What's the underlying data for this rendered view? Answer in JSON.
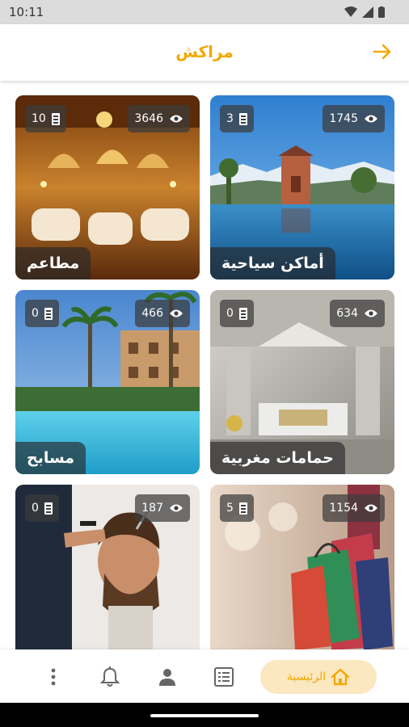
{
  "status_bar": {
    "time": "10:11"
  },
  "header": {
    "title": "مراكش"
  },
  "categories": [
    {
      "name": "أماكن سياحية",
      "views": "1745",
      "count": "3"
    },
    {
      "name": "مطاعم",
      "views": "3646",
      "count": "10"
    },
    {
      "name": "حمامات مغربية",
      "views": "634",
      "count": "0"
    },
    {
      "name": "مسابح",
      "views": "466",
      "count": "0"
    },
    {
      "name": "",
      "views": "1154",
      "count": "5"
    },
    {
      "name": "",
      "views": "187",
      "count": "0"
    }
  ],
  "bottom_nav": {
    "home_label": "الرئيسية"
  },
  "colors": {
    "accent": "#f2a900",
    "home_pill_bg": "#fbe7c0"
  }
}
